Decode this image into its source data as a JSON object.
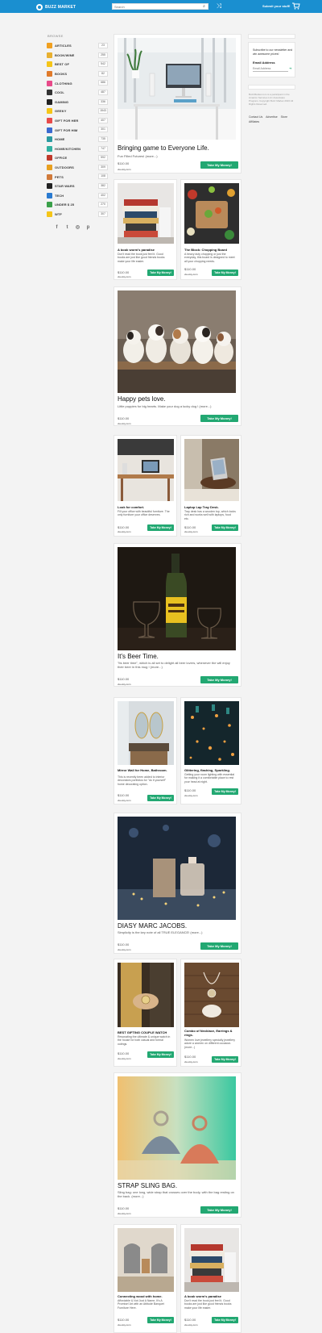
{
  "header": {
    "logo_text": "BUZZ MARKET",
    "search_placeholder": "Search",
    "submit_label": "Submit your stuff!",
    "icons": [
      "search-icon",
      "shuffle-icon",
      "cart-icon"
    ],
    "color": "#1a8fd0"
  },
  "sidebar": {
    "heading": "BROWSE",
    "categories": [
      {
        "label": "ARTICLES",
        "count": "23",
        "color": "#f0a020"
      },
      {
        "label": "BOOK/WINE",
        "count": "255",
        "color": "#e8b030"
      },
      {
        "label": "BEST OF",
        "count": "542",
        "color": "#f5c518"
      },
      {
        "label": "BOOKS",
        "count": "82",
        "color": "#e07a2a"
      },
      {
        "label": "CLOTHING",
        "count": "686",
        "color": "#e84a8a"
      },
      {
        "label": "COOL",
        "count": "487",
        "color": "#333333"
      },
      {
        "label": "GAMING",
        "count": "336",
        "color": "#222222"
      },
      {
        "label": "GEEKY",
        "count": "1543",
        "color": "#f5c518"
      },
      {
        "label": "GIFT FOR HER",
        "count": "407",
        "color": "#e84a4a"
      },
      {
        "label": "GIFT FOR HIM",
        "count": "301",
        "color": "#3a6ad0"
      },
      {
        "label": "HOME",
        "count": "735",
        "color": "#2a9aa0"
      },
      {
        "label": "HOME/KITCHEN",
        "count": "747",
        "color": "#30b0a0"
      },
      {
        "label": "OFFICE",
        "count": "592",
        "color": "#c0392b"
      },
      {
        "label": "OUTDOORS",
        "count": "309",
        "color": "#e8a020"
      },
      {
        "label": "PETS",
        "count": "108",
        "color": "#d07a3a"
      },
      {
        "label": "STAR WARS",
        "count": "382",
        "color": "#222222"
      },
      {
        "label": "TECH",
        "count": "402",
        "color": "#2a7ad0"
      },
      {
        "label": "UNDER $ 25",
        "count": "270",
        "color": "#3aa04a"
      },
      {
        "label": "WTF",
        "count": "307",
        "color": "#f5c518"
      }
    ],
    "social": [
      "f",
      "t",
      "◎",
      "p"
    ]
  },
  "right": {
    "newsletter_text": "Subscribe to our newsletter and win awesome prizes!",
    "email_label": "Email Address",
    "email_placeholder": "Email Address",
    "legal": "BuzzMarket.com is a participant in the Amazon Services LLC Associates Program. Copyright Buzz Market 2016 All Rights Reserved.",
    "links": [
      "Contact Us",
      "Advertise",
      "Store",
      "Affiliates"
    ]
  },
  "cards": {
    "c1": {
      "title": "Bringing game to Everyone Life.",
      "desc": "Fun Filled Futures! (more...)",
      "price": "$110.00",
      "via": "via etsy.com",
      "btn": "Take My Money!"
    },
    "c2a": {
      "title": "A book worm's paradise",
      "desc": "Don't read the book just feel it. Good books are just like good friends books make your life easier.",
      "price": "$110.00",
      "via": "via etsy.com",
      "btn": "Take My Money!"
    },
    "c2b": {
      "title": "The Block: Chopping Board",
      "desc": "A heavy duty chopping or just the everyday, this board is designed to meet all your chopping needs.",
      "price": "$110.00",
      "via": "via etsy.com",
      "btn": "Take My Money!"
    },
    "c3": {
      "title": "Happy pets love.",
      "desc": "Little puppies for big hearts. Make your dog a lucky dog ! (more...)",
      "price": "$110.00",
      "via": "via etsy.com",
      "btn": "Take My Money!"
    },
    "c4a": {
      "title": "Look for comfort.",
      "desc": "Fill your office with beautiful furniture. The only furniture your office deserves.",
      "price": "$110.00",
      "via": "via etsy.com",
      "btn": "Take My Money!"
    },
    "c4b": {
      "title": "Laptop Lap Tray Desk.",
      "desc": "Tray desk has a wooden top, which looks rich and works well with laptops, food etc.",
      "price": "$110.00",
      "via": "via etsy.com",
      "btn": "Take My Money!"
    },
    "c5": {
      "title": "It's Beer Time.",
      "desc": "\"Its beer time\", which is all set to delight all beer lovers, whenever the will enjoy their beer in this mug ! (more...)",
      "price": "$110.00",
      "via": "via etsy.com",
      "btn": "Take My Money!"
    },
    "c6a": {
      "title": "Mirror Wall for Home, Bathroom.",
      "desc": "This is recently been added to interior decorators portfolios for \"do it yourself\" home decorating option.",
      "price": "$110.00",
      "via": "via etsy.com",
      "btn": "Take My Money!"
    },
    "c6b": {
      "title": "Glittering, flashing, Sparkling.",
      "desc": "Getting your room lighting with essential for making it a comfortable place to rest your head at night.",
      "price": "$110.00",
      "via": "via etsy.com",
      "btn": "Take My Money!"
    },
    "c7": {
      "title": "DIASY MARC JACOBS.",
      "desc": "Simplicity is the key note of all TRUE ELEGANCE! (more...)",
      "price": "$110.00",
      "via": "via etsy.com",
      "btn": "Take My Money!"
    },
    "c8a": {
      "title": "BEST GIFTING COUPLE WATCH",
      "desc": "Resonating the ultimate & unique watch in the house for both casual and formal outings.",
      "price": "$110.00",
      "via": "via etsy.com",
      "btn": "Take My Money!"
    },
    "c8b": {
      "title": "Combo of Necklace, Earrings & rings.",
      "desc": "Women love jewellery specially jewellery adore a women on different occasion. (more...)",
      "price": "$110.00",
      "via": "via etsy.com",
      "btn": "Take My Money!"
    },
    "c9": {
      "title": "STRAP SLING BAG.",
      "desc": "Sling bag: one long, wide strap that crosses over the body, with the bag resting on the back. (more...)",
      "price": "$110.00",
      "via": "via etsy.com",
      "btn": "Take My Money!"
    },
    "c10a": {
      "title": "Connecting wood with home.",
      "desc": "Affordable & Not Just A Name, It's A Promise! Art with an Attitude Banquet Furniture Here.",
      "price": "$110.00",
      "via": "via etsy.com",
      "btn": "Take My Money!"
    },
    "c10b": {
      "title": "A book worm's paradise",
      "desc": "Don't read the book just feel it. Good books are just like good friends books make your life easier.",
      "price": "$110.00",
      "via": "via etsy.com",
      "btn": "Take My Money!"
    }
  }
}
